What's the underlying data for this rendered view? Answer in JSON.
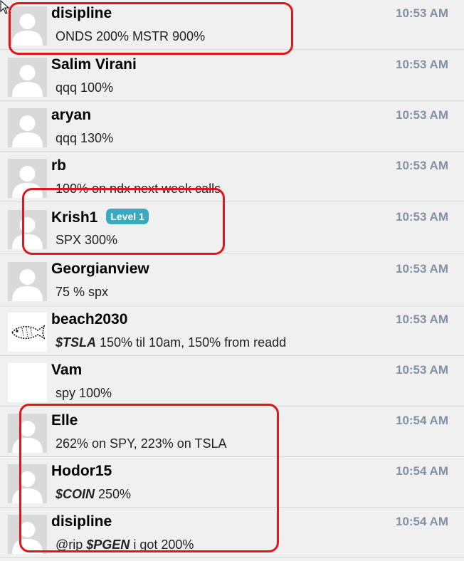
{
  "messages": [
    {
      "user": "disipline",
      "time": "10:53 AM",
      "avatar": "default",
      "text": [
        {
          "t": "ONDS 200% MSTR 900%",
          "ticker": false
        }
      ]
    },
    {
      "user": "Salim Virani",
      "time": "10:53 AM",
      "avatar": "default",
      "text": [
        {
          "t": "qqq 100%",
          "ticker": false
        }
      ]
    },
    {
      "user": "aryan",
      "time": "10:53 AM",
      "avatar": "default",
      "text": [
        {
          "t": "qqq 130%",
          "ticker": false
        }
      ]
    },
    {
      "user": "rb",
      "time": "10:53 AM",
      "avatar": "default",
      "text": [
        {
          "t": "100% on ndx next week calls",
          "ticker": false
        }
      ]
    },
    {
      "user": "Krish1",
      "badge": "Level 1",
      "time": "10:53 AM",
      "avatar": "default",
      "text": [
        {
          "t": "SPX 300%",
          "ticker": false
        }
      ]
    },
    {
      "user": "Georgianview",
      "time": "10:53 AM",
      "avatar": "default",
      "text": [
        {
          "t": "75 % spx",
          "ticker": false
        }
      ]
    },
    {
      "user": "beach2030",
      "time": "10:53 AM",
      "avatar": "fish",
      "text": [
        {
          "t": "$TSLA",
          "ticker": true
        },
        {
          "t": " 150% til 10am, 150% from readd",
          "ticker": false
        }
      ]
    },
    {
      "user": "Vam",
      "time": "10:53 AM",
      "avatar": "blank",
      "text": [
        {
          "t": "spy 100%",
          "ticker": false
        }
      ]
    },
    {
      "user": "Elle",
      "time": "10:54 AM",
      "avatar": "default",
      "text": [
        {
          "t": "262% on SPY, 223% on TSLA",
          "ticker": false
        }
      ]
    },
    {
      "user": "Hodor15",
      "time": "10:54 AM",
      "avatar": "default",
      "text": [
        {
          "t": "$COIN",
          "ticker": true
        },
        {
          "t": " 250%",
          "ticker": false
        }
      ]
    },
    {
      "user": "disipline",
      "time": "10:54 AM",
      "avatar": "default",
      "text": [
        {
          "t": "@rip ",
          "ticker": false
        },
        {
          "t": "$PGEN",
          "ticker": true
        },
        {
          "t": " i got 200%",
          "ticker": false
        }
      ]
    }
  ],
  "colors": {
    "highlight": "#e0161c",
    "badge": "#3aa9bd",
    "timestamp": "#8291a3",
    "row_background": "#f0f0f0"
  }
}
